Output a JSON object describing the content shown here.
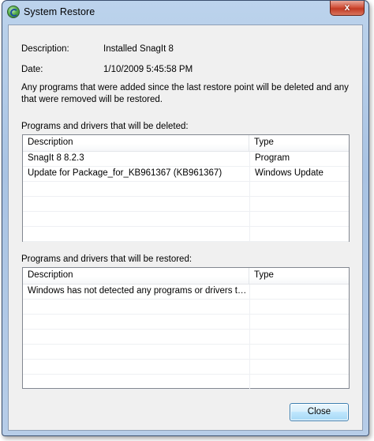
{
  "window": {
    "title": "System Restore",
    "app_icon": "system-restore-icon",
    "close_glyph": "x"
  },
  "details": {
    "description_label": "Description:",
    "description_value": "Installed SnagIt 8",
    "date_label": "Date:",
    "date_value": "1/10/2009 5:45:58 PM",
    "info_text": "Any programs that were added since the last restore point will be deleted and any that were removed will be restored."
  },
  "deleted": {
    "title": "Programs and drivers that will be deleted:",
    "columns": [
      "Description",
      "Type"
    ],
    "rows": [
      {
        "description": "SnagIt 8 8.2.3",
        "type": "Program"
      },
      {
        "description": "Update for Package_for_KB961367 (KB961367)",
        "type": "Windows Update"
      },
      {
        "description": "",
        "type": ""
      },
      {
        "description": "",
        "type": ""
      },
      {
        "description": "",
        "type": ""
      },
      {
        "description": "",
        "type": ""
      }
    ]
  },
  "restored": {
    "title": "Programs and drivers that will be restored:",
    "columns": [
      "Description",
      "Type"
    ],
    "rows": [
      {
        "description": "Windows has not detected any programs or drivers tha…",
        "type": ""
      },
      {
        "description": "",
        "type": ""
      },
      {
        "description": "",
        "type": ""
      },
      {
        "description": "",
        "type": ""
      },
      {
        "description": "",
        "type": ""
      },
      {
        "description": "",
        "type": ""
      },
      {
        "description": "",
        "type": ""
      }
    ]
  },
  "buttons": {
    "close_label": "Close"
  }
}
